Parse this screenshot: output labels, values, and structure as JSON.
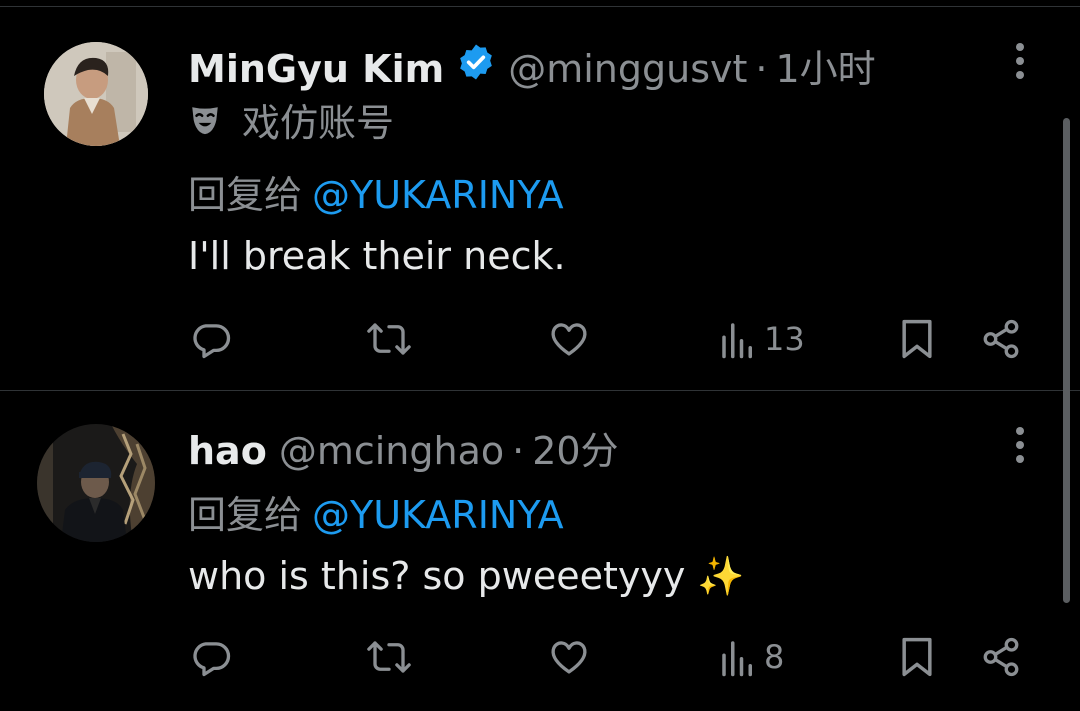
{
  "tweets": [
    {
      "display_name": "MinGyu Kim",
      "verified": true,
      "handle": "@minggusvt",
      "separator": "·",
      "time": "1小时",
      "label": "戏仿账号",
      "label_icon": "theater-mask-icon",
      "reply_prefix": "回复给",
      "reply_to": "@YUKARINYA",
      "text": "I'll break their neck.",
      "views": "13"
    },
    {
      "display_name": "hao",
      "verified": false,
      "handle": "@mcinghao",
      "separator": "·",
      "time": "20分",
      "reply_prefix": "回复给",
      "reply_to": "@YUKARINYA",
      "text": "who is this? so pweeetyyy ✨",
      "views": "8"
    }
  ],
  "icons": [
    "comment-icon",
    "retweet-icon",
    "like-icon",
    "views-icon",
    "bookmark-icon",
    "share-icon",
    "more-icon",
    "verified-icon"
  ],
  "colors": {
    "background": "#000000",
    "text": "#e7e9ea",
    "muted": "#8b8f93",
    "accent": "#1d9bf0",
    "divider": "#2f3336"
  }
}
